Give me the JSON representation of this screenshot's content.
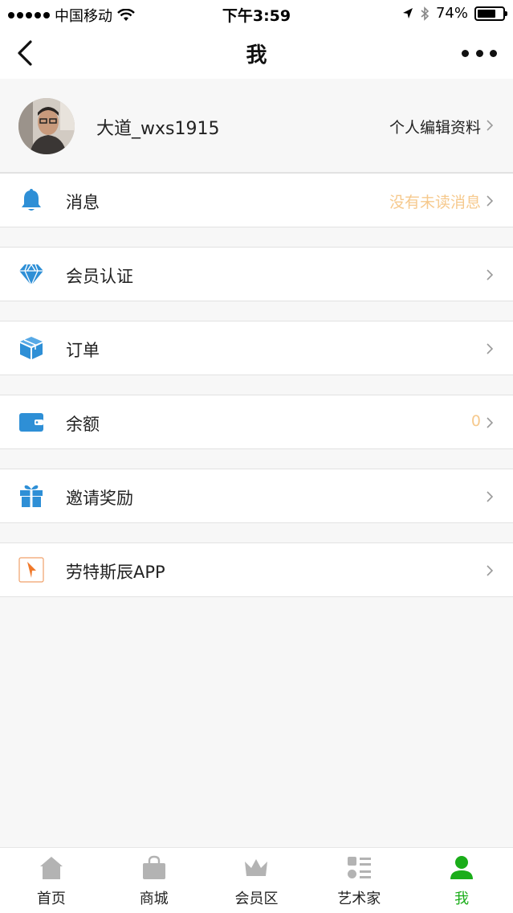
{
  "status_bar": {
    "carrier": "中国移动",
    "time": "下午3:59",
    "battery": "74%",
    "battery_level": 0.74
  },
  "nav": {
    "title": "我"
  },
  "profile": {
    "username": "大道_wxs1915",
    "edit_label": "个人编辑资料"
  },
  "menu": {
    "messages": {
      "label": "消息",
      "value": "没有未读消息"
    },
    "membership": {
      "label": "会员认证"
    },
    "orders": {
      "label": "订单"
    },
    "balance": {
      "label": "余额",
      "value": "0"
    },
    "invite": {
      "label": "邀请奖励"
    },
    "app": {
      "label": "劳特斯辰APP"
    }
  },
  "tabs": [
    {
      "label": "首页",
      "icon": "home-icon"
    },
    {
      "label": "商城",
      "icon": "shopping-bag-icon"
    },
    {
      "label": "会员区",
      "icon": "crown-icon"
    },
    {
      "label": "艺术家",
      "icon": "list-icon"
    },
    {
      "label": "我",
      "icon": "user-icon",
      "active": true
    }
  ],
  "colors": {
    "accent_blue": "#2e8fd6",
    "active_green": "#1aad19",
    "value_orange": "#f6c98d",
    "app_icon_orange": "#f0792b"
  }
}
